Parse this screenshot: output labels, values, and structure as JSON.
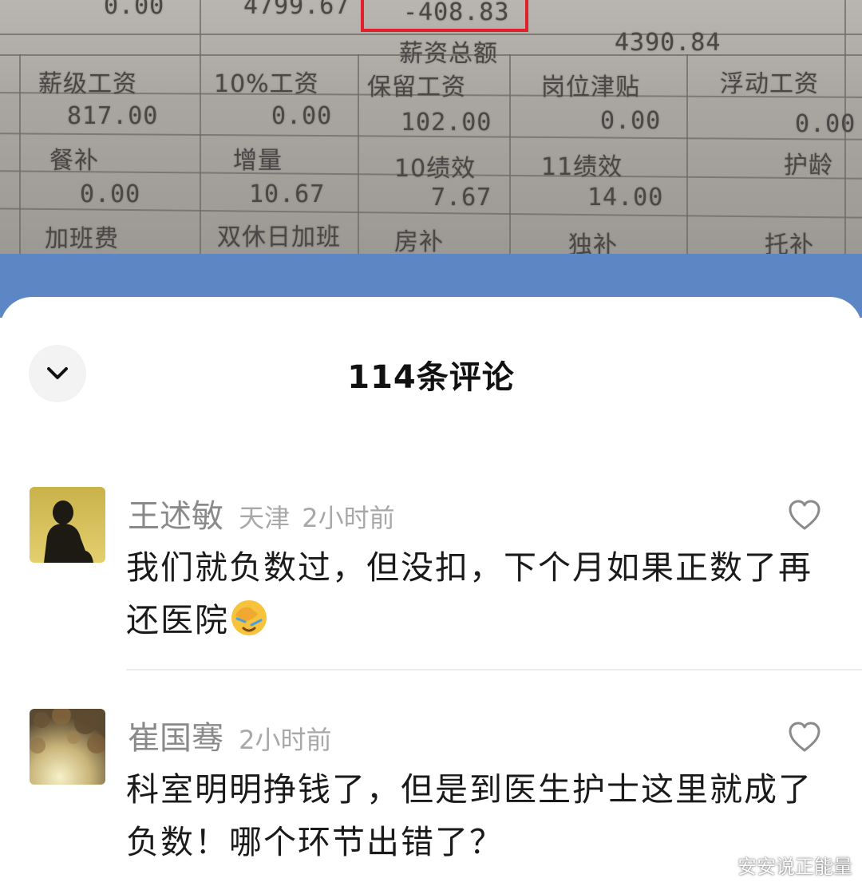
{
  "payslip": {
    "top_row": [
      "0.00",
      "4799.67",
      "-408.83"
    ],
    "total_label": "薪资总额",
    "total_value": "4390.84",
    "headers_1": [
      "薪级工资",
      "10%工资",
      "保留工资",
      "岗位津贴",
      "浮动工资"
    ],
    "values_1": [
      "817.00",
      "0.00",
      "102.00",
      "0.00",
      "0.00"
    ],
    "headers_2": [
      "餐补",
      "增量",
      "10绩效",
      "11绩效",
      "护龄"
    ],
    "values_2": [
      "0.00",
      "10.67",
      "7.67",
      "14.00"
    ],
    "headers_3": [
      "加班费",
      "双休日加班",
      "房补",
      "独补",
      "托补"
    ],
    "highlight_color": "#e0202a"
  },
  "sheet": {
    "title": "114条评论",
    "collapse_icon": "chevron-down-icon"
  },
  "comments": [
    {
      "username": "王述敏",
      "location": "天津",
      "time": "2小时前",
      "text": "我们就负数过，但没扣，下个月如果正数了再还医院",
      "emoji": "facepalm-crying-emoji"
    },
    {
      "username": "崔国骞",
      "location": "",
      "time": "2小时前",
      "text": "科室明明挣钱了，但是到医生护士这里就成了负数！哪个环节出错了？"
    }
  ],
  "watermark": "安安说正能量"
}
